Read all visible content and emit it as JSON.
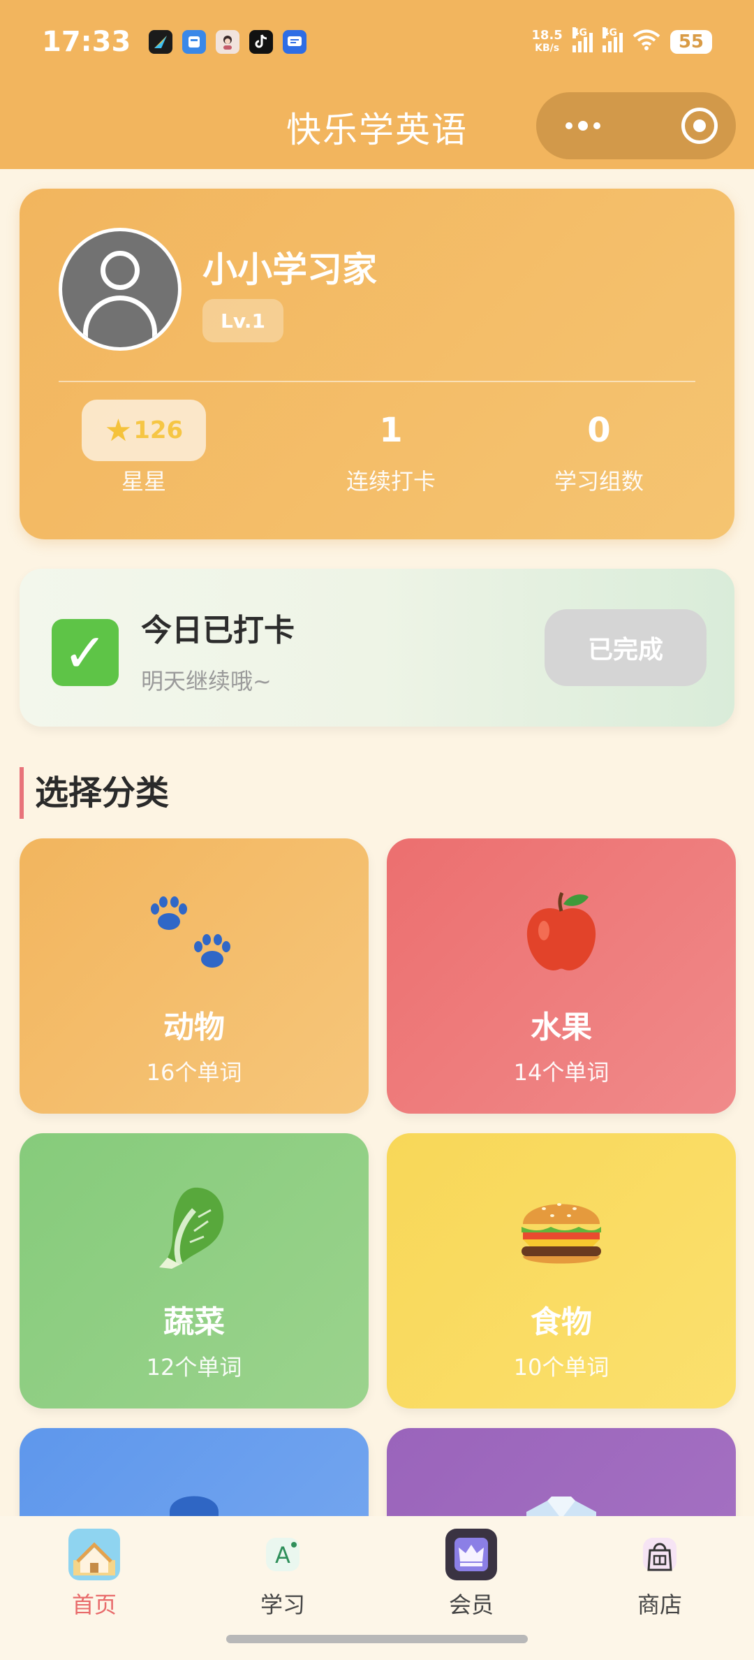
{
  "status_bar": {
    "time": "17:33",
    "net_speed_value": "18.5",
    "net_speed_unit": "KB/s",
    "signal1_label": "4G",
    "signal2_label": "4G",
    "battery": "55",
    "icons": [
      "app-icon-1",
      "app-icon-2",
      "app-icon-3",
      "tiktok-icon",
      "app-icon-5",
      "wifi-icon"
    ]
  },
  "title_bar": {
    "title": "快乐学英语",
    "more_icon": "more-dots-icon",
    "close_icon": "target-circle-icon"
  },
  "profile": {
    "name": "小小学习家",
    "level": "Lv.1",
    "stats": [
      {
        "value": "126",
        "label": "星星"
      },
      {
        "value": "1",
        "label": "连续打卡"
      },
      {
        "value": "0",
        "label": "学习组数"
      }
    ]
  },
  "checkin": {
    "title": "今日已打卡",
    "subtitle": "明天继续哦~",
    "button": "已完成"
  },
  "section_title": "选择分类",
  "categories": [
    {
      "name": "动物",
      "count": "16个单词",
      "icon": "paw-icon",
      "color": "#f2b55e"
    },
    {
      "name": "水果",
      "count": "14个单词",
      "icon": "apple-icon",
      "color": "#ec6f6f"
    },
    {
      "name": "蔬菜",
      "count": "12个单词",
      "icon": "cabbage-icon",
      "color": "#86cb7b"
    },
    {
      "name": "食物",
      "count": "10个单词",
      "icon": "burger-icon",
      "color": "#f8d758"
    },
    {
      "icon": "blue-shape-icon",
      "color": "#5e97ec"
    },
    {
      "icon": "shirt-icon",
      "color": "#9a64bb"
    }
  ],
  "tabs": [
    {
      "label": "首页",
      "icon": "home-icon",
      "active": true
    },
    {
      "label": "学习",
      "icon": "study-icon",
      "active": false
    },
    {
      "label": "会员",
      "icon": "crown-icon",
      "active": false
    },
    {
      "label": "商店",
      "icon": "shop-bag-icon",
      "active": false
    }
  ]
}
